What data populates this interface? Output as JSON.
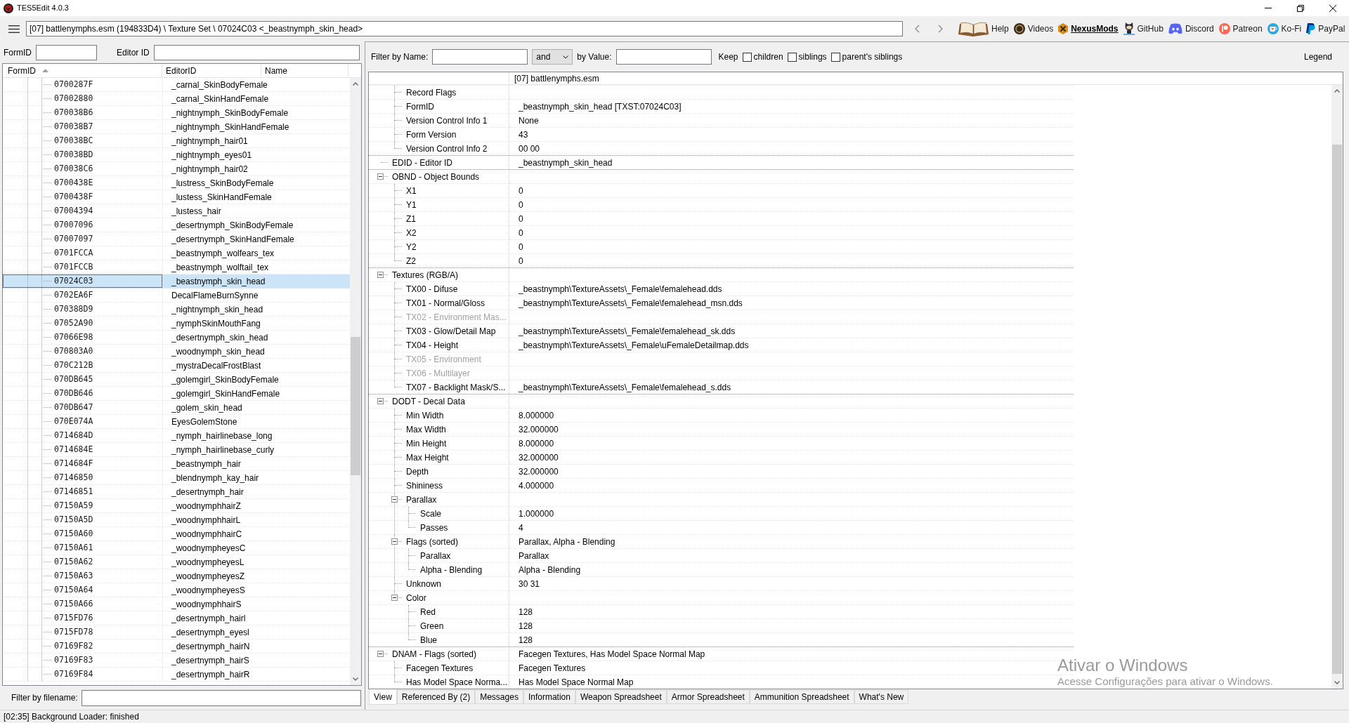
{
  "window": {
    "title": "TES5Edit 4.0.3"
  },
  "toolbar": {
    "path": "[07] battlenymphs.esm (194833D4) \\ Texture Set \\ 07024C03 <_beastnymph_skin_head>",
    "links": [
      {
        "label": "Help",
        "kind": "book",
        "highlighted": false
      },
      {
        "label": "Videos",
        "kind": "disc",
        "highlighted": false
      },
      {
        "label": "NexusMods",
        "kind": "hexagon",
        "highlighted": true
      },
      {
        "label": "GitHub",
        "kind": "figure",
        "highlighted": false
      },
      {
        "label": "Discord",
        "kind": "controller",
        "highlighted": false
      },
      {
        "label": "Patreon",
        "kind": "circle",
        "highlighted": false
      },
      {
        "label": "Ko-Fi",
        "kind": "cup",
        "highlighted": false
      },
      {
        "label": "PayPal",
        "kind": "pshape",
        "highlighted": false
      }
    ]
  },
  "left_panel": {
    "formid_label": "FormID",
    "editorid_label": "Editor ID",
    "columns": [
      {
        "label": "FormID",
        "sorted": true
      },
      {
        "label": "EditorID",
        "sorted": false
      },
      {
        "label": "Name",
        "sorted": false
      }
    ],
    "rows": [
      {
        "form_id": "0700287F",
        "editor_id": "_carnal_SkinBodyFemale",
        "selected": false
      },
      {
        "form_id": "07002880",
        "editor_id": "_carnal_SkinHandFemale",
        "selected": false
      },
      {
        "form_id": "070038B6",
        "editor_id": "_nightnymph_SkinBodyFemale",
        "selected": false
      },
      {
        "form_id": "070038B7",
        "editor_id": "_nightnymph_SkinHandFemale",
        "selected": false
      },
      {
        "form_id": "070038BC",
        "editor_id": "_nightnymph_hair01",
        "selected": false
      },
      {
        "form_id": "070038BD",
        "editor_id": "_nightnymph_eyes01",
        "selected": false
      },
      {
        "form_id": "070038C6",
        "editor_id": "_nightnymph_hair02",
        "selected": false
      },
      {
        "form_id": "0700438E",
        "editor_id": "_lustress_SkinBodyFemale",
        "selected": false
      },
      {
        "form_id": "0700438F",
        "editor_id": "_lustess_SkinHandFemale",
        "selected": false
      },
      {
        "form_id": "07004394",
        "editor_id": "_lustess_hair",
        "selected": false
      },
      {
        "form_id": "07007096",
        "editor_id": "_desertnymph_SkinBodyFemale",
        "selected": false
      },
      {
        "form_id": "07007097",
        "editor_id": "_desertnymph_SkinHandFemale",
        "selected": false
      },
      {
        "form_id": "0701FCCA",
        "editor_id": "_beastnymph_wolfears_tex",
        "selected": false
      },
      {
        "form_id": "0701FCCB",
        "editor_id": "_beastnymph_wolftail_tex",
        "selected": false
      },
      {
        "form_id": "07024C03",
        "editor_id": "_beastnymph_skin_head",
        "selected": true
      },
      {
        "form_id": "0702EA6F",
        "editor_id": "DecalFlameBurnSynne",
        "selected": false
      },
      {
        "form_id": "070388D9",
        "editor_id": "_nightnymph_skin_head",
        "selected": false
      },
      {
        "form_id": "07052A90",
        "editor_id": "_nymphSkinMouthFang",
        "selected": false
      },
      {
        "form_id": "07066E98",
        "editor_id": "_desertnymph_skin_head",
        "selected": false
      },
      {
        "form_id": "070803A0",
        "editor_id": "_woodnymph_skin_head",
        "selected": false
      },
      {
        "form_id": "070C212B",
        "editor_id": "_mystraDecalFrostBlast",
        "selected": false
      },
      {
        "form_id": "070DB645",
        "editor_id": "_golemgirl_SkinBodyFemale",
        "selected": false
      },
      {
        "form_id": "070DB646",
        "editor_id": "_golemgirl_SkinHandFemale",
        "selected": false
      },
      {
        "form_id": "070DB647",
        "editor_id": "_golem_skin_head",
        "selected": false
      },
      {
        "form_id": "070E074A",
        "editor_id": "EyesGolemStone",
        "selected": false
      },
      {
        "form_id": "0714684D",
        "editor_id": "_nymph_hairlinebase_long",
        "selected": false
      },
      {
        "form_id": "0714684E",
        "editor_id": "_nymph_hairlinebase_curly",
        "selected": false
      },
      {
        "form_id": "0714684F",
        "editor_id": "_beastnymph_hair",
        "selected": false
      },
      {
        "form_id": "07146850",
        "editor_id": "_blendnymph_kay_hair",
        "selected": false
      },
      {
        "form_id": "07146851",
        "editor_id": "_desertnymph_hair",
        "selected": false
      },
      {
        "form_id": "07150A59",
        "editor_id": "_woodnymphhairZ",
        "selected": false
      },
      {
        "form_id": "07150A5D",
        "editor_id": "_woodnymphhairL",
        "selected": false
      },
      {
        "form_id": "07150A60",
        "editor_id": "_woodnymphhairC",
        "selected": false
      },
      {
        "form_id": "07150A61",
        "editor_id": "_woodnympheyesC",
        "selected": false
      },
      {
        "form_id": "07150A62",
        "editor_id": "_woodnympheyesL",
        "selected": false
      },
      {
        "form_id": "07150A63",
        "editor_id": "_woodnympheyesZ",
        "selected": false
      },
      {
        "form_id": "07150A64",
        "editor_id": "_woodnympheyesS",
        "selected": false
      },
      {
        "form_id": "07150A66",
        "editor_id": "_woodnymphhairS",
        "selected": false
      },
      {
        "form_id": "0715FD76",
        "editor_id": "_desertnymph_hairl",
        "selected": false
      },
      {
        "form_id": "0715FD78",
        "editor_id": "_desertnymph_eyesl",
        "selected": false
      },
      {
        "form_id": "07169F82",
        "editor_id": "_desertnymph_hairN",
        "selected": false
      },
      {
        "form_id": "07169F83",
        "editor_id": "_desertnymph_hairS",
        "selected": false
      },
      {
        "form_id": "07169F84",
        "editor_id": "_desertnymph_hairR",
        "selected": false
      }
    ],
    "filename_filter_label": "Filter by filename:"
  },
  "right_panel": {
    "filter": {
      "name_label": "Filter by Name:",
      "operator": "and",
      "value_label": "by Value:",
      "keep_label": "Keep",
      "options": [
        {
          "label": "children",
          "checked": false
        },
        {
          "label": "siblings",
          "checked": false
        },
        {
          "label": "parent's siblings",
          "checked": false
        }
      ],
      "legend": "Legend"
    },
    "record": {
      "header": "[07] battlenymphs.esm",
      "nodes": [
        {
          "children": [
            {
              "label": "Record Flags"
            },
            {
              "label": "FormID",
              "value": "_beastnymph_skin_head [TXST:07024C03]"
            },
            {
              "label": "Version Control Info 1",
              "value": "None"
            },
            {
              "label": "Form Version",
              "value": "43"
            },
            {
              "label": "Version Control Info 2",
              "value": "00 00"
            }
          ]
        },
        {
          "label": "EDID - Editor ID",
          "value": "_beastnymph_skin_head"
        },
        {
          "label": "OBND - Object Bounds",
          "expanded": true,
          "children": [
            {
              "label": "X1",
              "value": "0"
            },
            {
              "label": "Y1",
              "value": "0"
            },
            {
              "label": "Z1",
              "value": "0"
            },
            {
              "label": "X2",
              "value": "0"
            },
            {
              "label": "Y2",
              "value": "0"
            },
            {
              "label": "Z2",
              "value": "0"
            }
          ]
        },
        {
          "label": "Textures (RGB/A)",
          "expanded": true,
          "children": [
            {
              "label": "TX00 - Difuse",
              "value": "_beastnymph\\TextureAssets\\_Female\\femalehead.dds",
              "disabled": false
            },
            {
              "label": "TX01 - Normal/Gloss",
              "value": "_beastnymph\\TextureAssets\\_Female\\femalehead_msn.dds",
              "disabled": false
            },
            {
              "label": "TX02 - Environment Mas...",
              "disabled": true
            },
            {
              "label": "TX03 - Glow/Detail Map",
              "value": "_beastnymph\\TextureAssets\\_Female\\femalehead_sk.dds",
              "disabled": false
            },
            {
              "label": "TX04 - Height",
              "value": "_beastnymph\\TextureAssets\\_Female\\uFemaleDetailmap.dds",
              "disabled": false
            },
            {
              "label": "TX05 - Environment",
              "disabled": true
            },
            {
              "label": "TX06 - Multilayer",
              "disabled": true
            },
            {
              "label": "TX07 - Backlight Mask/S...",
              "value": "_beastnymph\\TextureAssets\\_Female\\femalehead_s.dds",
              "disabled": false
            }
          ]
        },
        {
          "label": "DODT - Decal Data",
          "expanded": true,
          "children": [
            {
              "label": "Min Width",
              "value": "8.000000"
            },
            {
              "label": "Max Width",
              "value": "32.000000"
            },
            {
              "label": "Min Height",
              "value": "8.000000"
            },
            {
              "label": "Max Height",
              "value": "32.000000"
            },
            {
              "label": "Depth",
              "value": "32.000000"
            },
            {
              "label": "Shininess",
              "value": "4.000000"
            },
            {
              "label": "Parallax",
              "expanded": true,
              "children": [
                {
                  "label": "Scale",
                  "value": "1.000000"
                },
                {
                  "label": "Passes",
                  "value": "4"
                }
              ]
            },
            {
              "label": "Flags (sorted)",
              "value": "Parallax, Alpha - Blending",
              "expanded": true,
              "children": [
                {
                  "label": "Parallax",
                  "value": "Parallax"
                },
                {
                  "label": "Alpha - Blending",
                  "value": "Alpha - Blending"
                }
              ]
            },
            {
              "label": "Unknown",
              "value": "30 31"
            },
            {
              "label": "Color",
              "expanded": true,
              "children": [
                {
                  "label": "Red",
                  "value": "128"
                },
                {
                  "label": "Green",
                  "value": "128"
                },
                {
                  "label": "Blue",
                  "value": "128"
                }
              ]
            }
          ]
        },
        {
          "label": "DNAM - Flags (sorted)",
          "value": "Facegen Textures, Has Model Space Normal Map",
          "expanded": true,
          "children": [
            {
              "label": "Facegen Textures",
              "value": "Facegen Textures"
            },
            {
              "label": "Has Model Space Norma...",
              "value": "Has Model Space Normal Map"
            }
          ]
        }
      ]
    },
    "tabs": [
      {
        "label": "View",
        "selected": true
      },
      {
        "label": "Referenced By (2)",
        "selected": false
      },
      {
        "label": "Messages",
        "selected": false
      },
      {
        "label": "Information",
        "selected": false
      },
      {
        "label": "Weapon Spreadsheet",
        "selected": false
      },
      {
        "label": "Armor Spreadsheet",
        "selected": false
      },
      {
        "label": "Ammunition Spreadsheet",
        "selected": false
      },
      {
        "label": "What's New",
        "selected": false
      }
    ]
  },
  "activation_notice": {
    "title": "Ativar o Windows",
    "text": "Acesse Configurações para ativar o Windows."
  },
  "status_bar": "[02:35] Background Loader: finished"
}
